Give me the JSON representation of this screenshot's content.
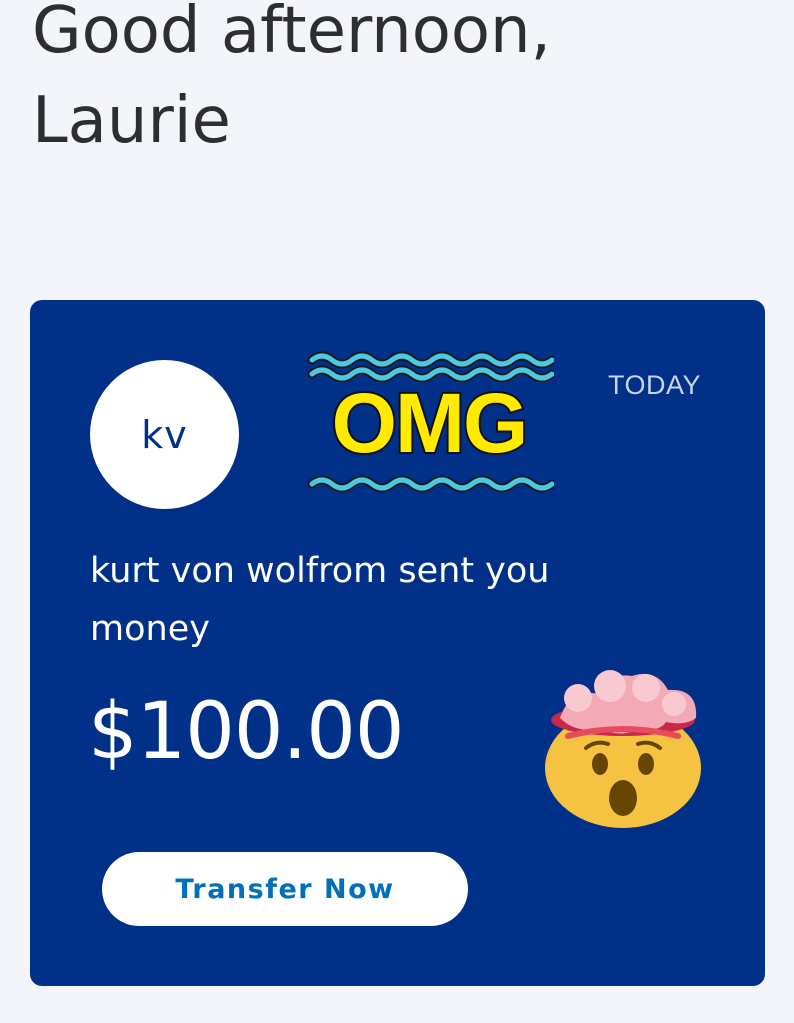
{
  "header": {
    "greeting": "Good afternoon, Laurie"
  },
  "notification": {
    "avatar_initials": "kv",
    "sticker_text": "OMG",
    "date": "TODAY",
    "message": "kurt von wolfrom sent you money",
    "amount": "$100.00",
    "emoji": "exploding-head",
    "button_label": "Transfer Now"
  },
  "colors": {
    "background": "#f4f5fa",
    "card": "#003087",
    "button_text": "#0070ba",
    "sticker_fill": "#ffea00",
    "sticker_waves": "#4cc9e0"
  }
}
